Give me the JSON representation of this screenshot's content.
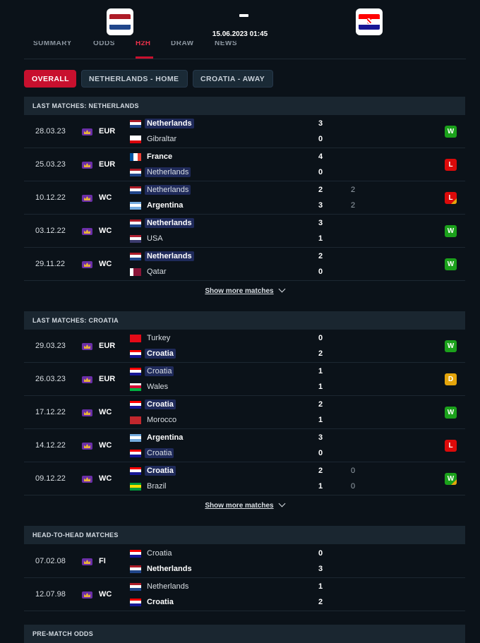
{
  "header": {
    "home_team": "Netherlands",
    "away_team": "Croatia",
    "score_separator": "-",
    "datetime": "15.06.2023 01:45"
  },
  "tabs": [
    {
      "label": "SUMMARY",
      "active": false
    },
    {
      "label": "ODDS",
      "active": false
    },
    {
      "label": "H2H",
      "active": true
    },
    {
      "label": "DRAW",
      "active": false
    },
    {
      "label": "NEWS",
      "active": false
    }
  ],
  "filters": {
    "overall": "OVERALL",
    "home": "NETHERLANDS - HOME",
    "away": "CROATIA - AWAY"
  },
  "colors": {
    "accent": "#c8102e",
    "win": "#1ba11b",
    "loss": "#dc0a0a",
    "draw": "#e5a50b",
    "background": "#0b1219"
  },
  "sections": {
    "netherlands": {
      "title": "LAST MATCHES: NETHERLANDS",
      "show_more": "Show more matches",
      "matches": [
        {
          "date": "28.03.23",
          "comp": "EUR",
          "team1": "Netherlands",
          "flag1": "nl",
          "score1": "3",
          "team2": "Gibraltar",
          "flag2": "gi",
          "score2": "0",
          "result": "W"
        },
        {
          "date": "25.03.23",
          "comp": "EUR",
          "team1": "France",
          "flag1": "fr",
          "score1": "4",
          "team2": "Netherlands",
          "flag2": "nl",
          "score2": "0",
          "result": "L"
        },
        {
          "date": "10.12.22",
          "comp": "WC",
          "team1": "Netherlands",
          "flag1": "nl",
          "score1": "2",
          "pen1": "2",
          "team2": "Argentina",
          "flag2": "ar",
          "score2": "3",
          "pen2": "2",
          "result": "L"
        },
        {
          "date": "03.12.22",
          "comp": "WC",
          "team1": "Netherlands",
          "flag1": "nl",
          "score1": "3",
          "team2": "USA",
          "flag2": "us",
          "score2": "1",
          "result": "W"
        },
        {
          "date": "29.11.22",
          "comp": "WC",
          "team1": "Netherlands",
          "flag1": "nl",
          "score1": "2",
          "team2": "Qatar",
          "flag2": "qa",
          "score2": "0",
          "result": "W"
        }
      ]
    },
    "croatia": {
      "title": "LAST MATCHES: CROATIA",
      "show_more": "Show more matches",
      "matches": [
        {
          "date": "29.03.23",
          "comp": "EUR",
          "team1": "Turkey",
          "flag1": "tr",
          "score1": "0",
          "team2": "Croatia",
          "flag2": "hr",
          "score2": "2",
          "result": "W"
        },
        {
          "date": "26.03.23",
          "comp": "EUR",
          "team1": "Croatia",
          "flag1": "hr",
          "score1": "1",
          "team2": "Wales",
          "flag2": "wa",
          "score2": "1",
          "result": "D"
        },
        {
          "date": "17.12.22",
          "comp": "WC",
          "team1": "Croatia",
          "flag1": "hr",
          "score1": "2",
          "team2": "Morocco",
          "flag2": "ma",
          "score2": "1",
          "result": "W"
        },
        {
          "date": "14.12.22",
          "comp": "WC",
          "team1": "Argentina",
          "flag1": "ar",
          "score1": "3",
          "team2": "Croatia",
          "flag2": "hr",
          "score2": "0",
          "result": "L"
        },
        {
          "date": "09.12.22",
          "comp": "WC",
          "team1": "Croatia",
          "flag1": "hr",
          "score1": "2",
          "pen1": "0",
          "team2": "Brazil",
          "flag2": "br",
          "score2": "1",
          "pen2": "0",
          "result": "W"
        }
      ]
    },
    "h2h": {
      "title": "HEAD-TO-HEAD MATCHES",
      "matches": [
        {
          "date": "07.02.08",
          "comp": "FI",
          "team1": "Croatia",
          "flag1": "hr",
          "score1": "0",
          "team2": "Netherlands",
          "flag2": "nl",
          "score2": "3"
        },
        {
          "date": "12.07.98",
          "comp": "WC",
          "team1": "Netherlands",
          "flag1": "nl",
          "score1": "1",
          "team2": "Croatia",
          "flag2": "hr",
          "score2": "2"
        }
      ]
    },
    "odds": {
      "title": "PRE-MATCH ODDS"
    }
  }
}
